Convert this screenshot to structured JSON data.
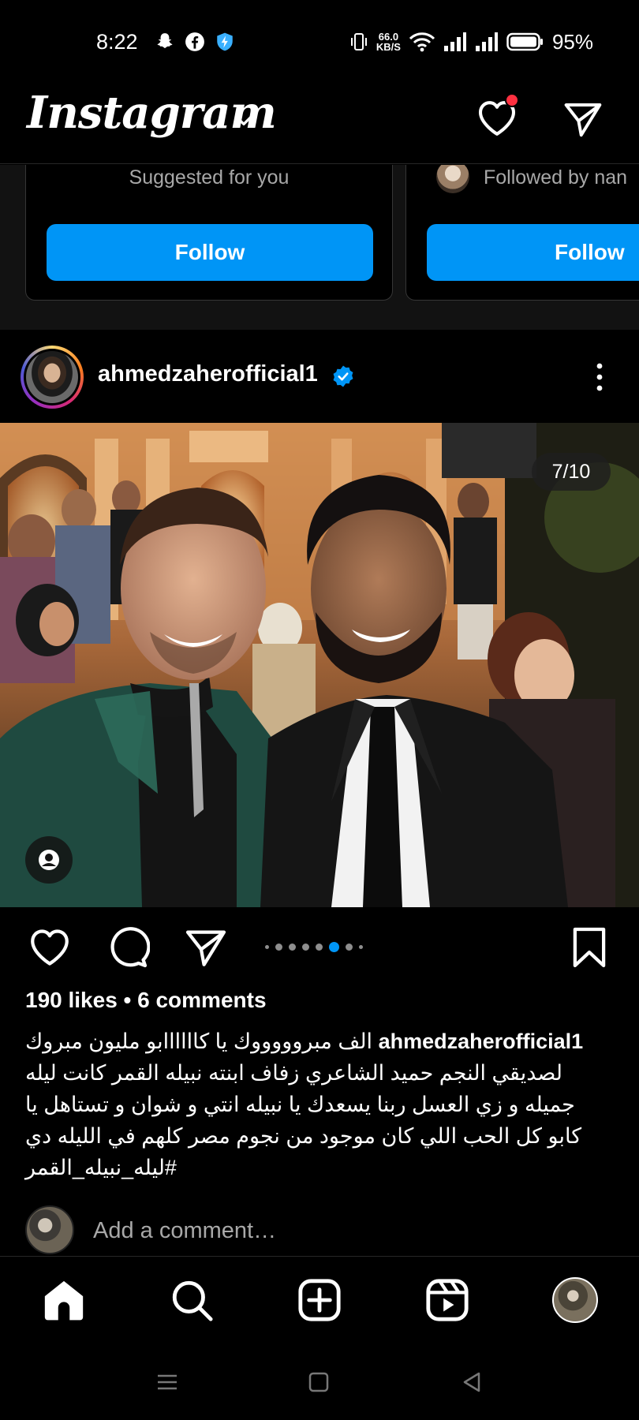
{
  "status_bar": {
    "time": "8:22",
    "net_speed_value": "66.0",
    "net_speed_unit": "KB/S",
    "battery": "95%"
  },
  "header": {
    "logo": "Instagram"
  },
  "suggestions": {
    "card1_text": "Suggested for you",
    "card2_text": "Followed by nan",
    "follow_label": "Follow"
  },
  "post": {
    "username": "ahmedzaherofficial1",
    "counter": "7/10",
    "likes_comments": "190 likes • 6 comments",
    "caption_user": "ahmedzaherofficial1",
    "caption_lines": [
      "الف مبروووووك يا كاااااابو مليون مبروك",
      "لصديقي النجم حميد الشاعري زفاف ابنته نبيله القمر  كانت ليله",
      "جميله و زي العسل ربنا يسعدك يا نبيله انتي و شوان  و تستاهل يا",
      "كابو كل الحب اللي كان موجود من نجوم مصر كلهم في الليله دي",
      "#ليله_نبيله_القمر"
    ],
    "comment_placeholder": "Add a comment…",
    "carousel_dots": 8,
    "carousel_active": 5
  },
  "colors": {
    "accent": "#0095f6",
    "notification": "#ff3040",
    "muted": "#a8a8a8"
  },
  "icons": {
    "header": [
      "heart-icon",
      "direct-send-icon"
    ],
    "actions": [
      "heart-icon",
      "comment-icon",
      "share-icon",
      "bookmark-icon"
    ],
    "nav": [
      "home-icon",
      "search-icon",
      "create-icon",
      "reels-icon",
      "profile-avatar"
    ]
  }
}
